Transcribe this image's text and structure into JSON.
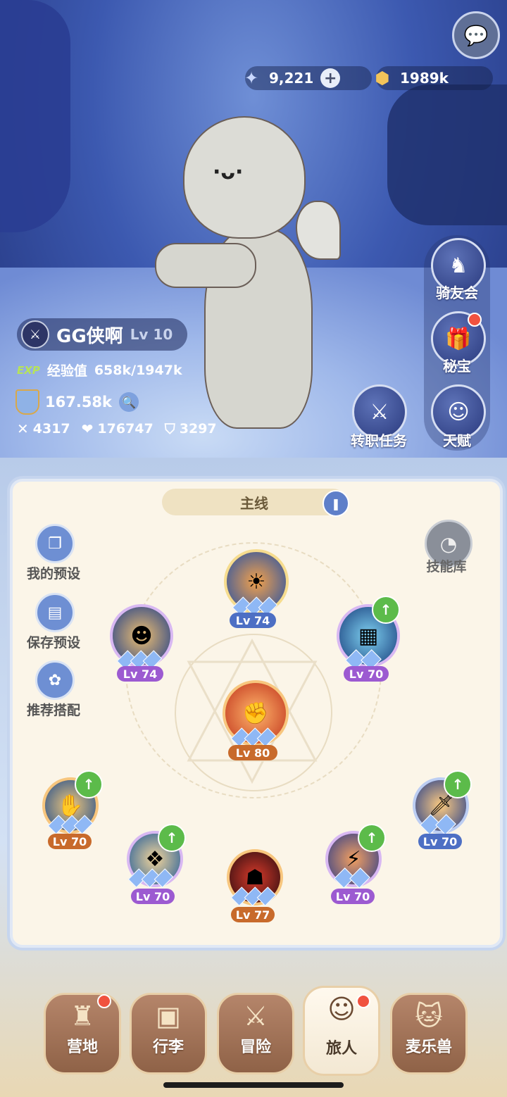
{
  "currency": {
    "gems": "9,221",
    "coins": "1989k",
    "gem_icon": "crystal-star-icon",
    "coin_icon": "gold-coin-icon"
  },
  "player": {
    "name": "GG侠啊",
    "level": "Lv 10",
    "exp_tag": "EXP",
    "exp_label": "经验值",
    "exp_value": "658k/1947k",
    "power": "167.58k",
    "attack": "4317",
    "hp": "176747",
    "defense": "3297"
  },
  "right_buttons": {
    "mount_club": "骑友会",
    "treasure": "秘宝",
    "class_quest": "转职任务",
    "talent": "天赋"
  },
  "panel": {
    "tab": "主线",
    "my_preset": "我的预设",
    "save_preset": "保存预设",
    "recommend": "推荐搭配",
    "skill_library": "技能库"
  },
  "skills": [
    {
      "level": "Lv 74",
      "stars": 3,
      "upgrade": false
    },
    {
      "level": "Lv 74",
      "stars": 3,
      "upgrade": false
    },
    {
      "level": "Lv 70",
      "stars": 2,
      "upgrade": true
    },
    {
      "level": "Lv 80",
      "stars": 3,
      "upgrade": false
    },
    {
      "level": "Lv 70",
      "stars": 3,
      "upgrade": true
    },
    {
      "level": "Lv 70",
      "stars": 2,
      "upgrade": true
    },
    {
      "level": "Lv 70",
      "stars": 3,
      "upgrade": true
    },
    {
      "level": "Lv 77",
      "stars": 3,
      "upgrade": false
    },
    {
      "level": "Lv 70",
      "stars": 2,
      "upgrade": true
    }
  ],
  "nav": {
    "camp": "营地",
    "bag": "行李",
    "adventure": "冒险",
    "traveler": "旅人",
    "pet": "麦乐兽"
  },
  "colors": {
    "lv_blue": "#4d6fc4",
    "lv_purple": "#9c5ad1",
    "lv_orange": "#c86a2b",
    "upgrade_green": "#5cbb4a",
    "badge_red": "#f0523f"
  }
}
